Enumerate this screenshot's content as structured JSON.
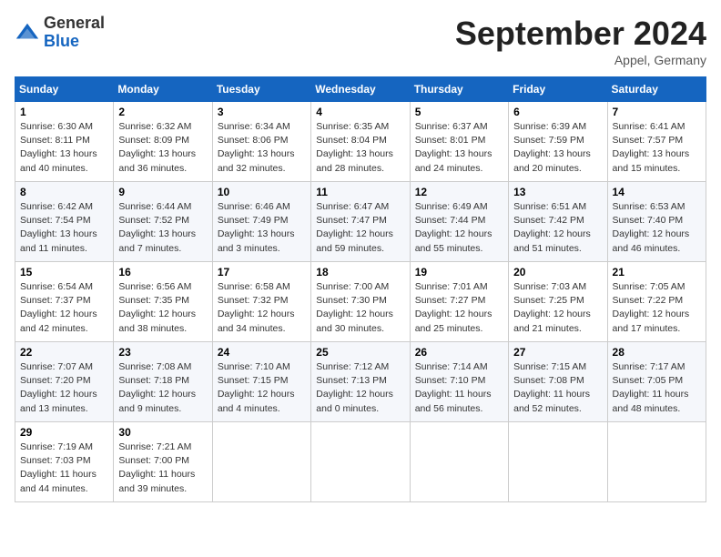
{
  "logo": {
    "general": "General",
    "blue": "Blue"
  },
  "title": "September 2024",
  "location": "Appel, Germany",
  "days_header": [
    "Sunday",
    "Monday",
    "Tuesday",
    "Wednesday",
    "Thursday",
    "Friday",
    "Saturday"
  ],
  "weeks": [
    [
      {
        "day": "1",
        "sunrise": "6:30 AM",
        "sunset": "8:11 PM",
        "daylight": "13 hours and 40 minutes."
      },
      {
        "day": "2",
        "sunrise": "6:32 AM",
        "sunset": "8:09 PM",
        "daylight": "13 hours and 36 minutes."
      },
      {
        "day": "3",
        "sunrise": "6:34 AM",
        "sunset": "8:06 PM",
        "daylight": "13 hours and 32 minutes."
      },
      {
        "day": "4",
        "sunrise": "6:35 AM",
        "sunset": "8:04 PM",
        "daylight": "13 hours and 28 minutes."
      },
      {
        "day": "5",
        "sunrise": "6:37 AM",
        "sunset": "8:01 PM",
        "daylight": "13 hours and 24 minutes."
      },
      {
        "day": "6",
        "sunrise": "6:39 AM",
        "sunset": "7:59 PM",
        "daylight": "13 hours and 20 minutes."
      },
      {
        "day": "7",
        "sunrise": "6:41 AM",
        "sunset": "7:57 PM",
        "daylight": "13 hours and 15 minutes."
      }
    ],
    [
      {
        "day": "8",
        "sunrise": "6:42 AM",
        "sunset": "7:54 PM",
        "daylight": "13 hours and 11 minutes."
      },
      {
        "day": "9",
        "sunrise": "6:44 AM",
        "sunset": "7:52 PM",
        "daylight": "13 hours and 7 minutes."
      },
      {
        "day": "10",
        "sunrise": "6:46 AM",
        "sunset": "7:49 PM",
        "daylight": "13 hours and 3 minutes."
      },
      {
        "day": "11",
        "sunrise": "6:47 AM",
        "sunset": "7:47 PM",
        "daylight": "12 hours and 59 minutes."
      },
      {
        "day": "12",
        "sunrise": "6:49 AM",
        "sunset": "7:44 PM",
        "daylight": "12 hours and 55 minutes."
      },
      {
        "day": "13",
        "sunrise": "6:51 AM",
        "sunset": "7:42 PM",
        "daylight": "12 hours and 51 minutes."
      },
      {
        "day": "14",
        "sunrise": "6:53 AM",
        "sunset": "7:40 PM",
        "daylight": "12 hours and 46 minutes."
      }
    ],
    [
      {
        "day": "15",
        "sunrise": "6:54 AM",
        "sunset": "7:37 PM",
        "daylight": "12 hours and 42 minutes."
      },
      {
        "day": "16",
        "sunrise": "6:56 AM",
        "sunset": "7:35 PM",
        "daylight": "12 hours and 38 minutes."
      },
      {
        "day": "17",
        "sunrise": "6:58 AM",
        "sunset": "7:32 PM",
        "daylight": "12 hours and 34 minutes."
      },
      {
        "day": "18",
        "sunrise": "7:00 AM",
        "sunset": "7:30 PM",
        "daylight": "12 hours and 30 minutes."
      },
      {
        "day": "19",
        "sunrise": "7:01 AM",
        "sunset": "7:27 PM",
        "daylight": "12 hours and 25 minutes."
      },
      {
        "day": "20",
        "sunrise": "7:03 AM",
        "sunset": "7:25 PM",
        "daylight": "12 hours and 21 minutes."
      },
      {
        "day": "21",
        "sunrise": "7:05 AM",
        "sunset": "7:22 PM",
        "daylight": "12 hours and 17 minutes."
      }
    ],
    [
      {
        "day": "22",
        "sunrise": "7:07 AM",
        "sunset": "7:20 PM",
        "daylight": "12 hours and 13 minutes."
      },
      {
        "day": "23",
        "sunrise": "7:08 AM",
        "sunset": "7:18 PM",
        "daylight": "12 hours and 9 minutes."
      },
      {
        "day": "24",
        "sunrise": "7:10 AM",
        "sunset": "7:15 PM",
        "daylight": "12 hours and 4 minutes."
      },
      {
        "day": "25",
        "sunrise": "7:12 AM",
        "sunset": "7:13 PM",
        "daylight": "12 hours and 0 minutes."
      },
      {
        "day": "26",
        "sunrise": "7:14 AM",
        "sunset": "7:10 PM",
        "daylight": "11 hours and 56 minutes."
      },
      {
        "day": "27",
        "sunrise": "7:15 AM",
        "sunset": "7:08 PM",
        "daylight": "11 hours and 52 minutes."
      },
      {
        "day": "28",
        "sunrise": "7:17 AM",
        "sunset": "7:05 PM",
        "daylight": "11 hours and 48 minutes."
      }
    ],
    [
      {
        "day": "29",
        "sunrise": "7:19 AM",
        "sunset": "7:03 PM",
        "daylight": "11 hours and 44 minutes."
      },
      {
        "day": "30",
        "sunrise": "7:21 AM",
        "sunset": "7:00 PM",
        "daylight": "11 hours and 39 minutes."
      },
      null,
      null,
      null,
      null,
      null
    ]
  ]
}
